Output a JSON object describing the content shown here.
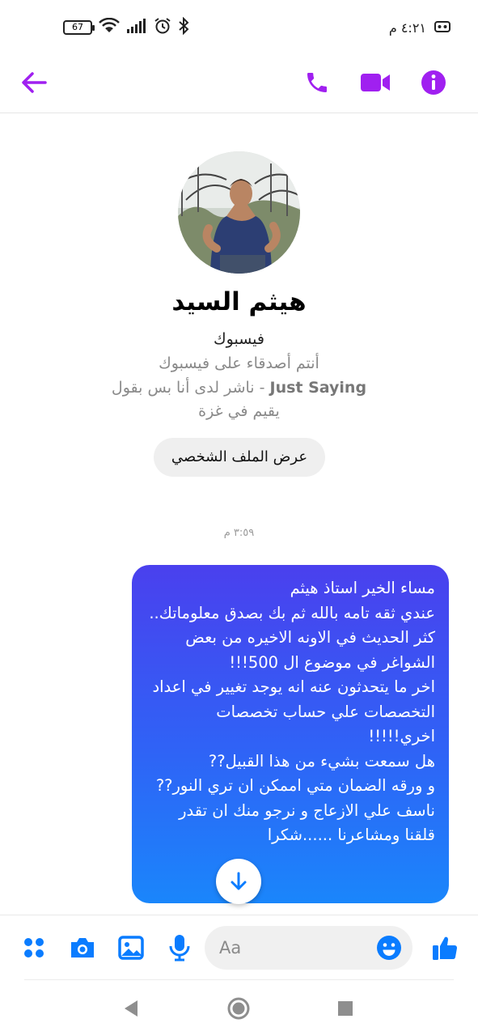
{
  "status_bar": {
    "battery": "67",
    "time": "٤:٢١ م"
  },
  "header": {
    "back_icon": "arrow-left-icon",
    "call_icon": "phone-icon",
    "video_icon": "video-camera-icon",
    "info_icon": "info-icon",
    "accent_color": "#a020f0"
  },
  "profile": {
    "name": "هيثم السيد",
    "platform": "فيسبوك",
    "friends_line": "أنتم أصدقاء على فيسبوك",
    "page_line_bold": "Just Saying",
    "page_line_rest": " - ناشر لدى أنا بس بقول",
    "location": "يقيم في غزة",
    "view_profile_button": "عرض الملف الشخصي"
  },
  "conversation": {
    "timestamp": "٣:٥٩ م",
    "messages": [
      {
        "direction": "outgoing",
        "text": "مساء الخير استاذ هيثم\nعندي ثقه تامه بالله ثم بك بصدق معلوماتك..\nكثر الحديث في الاونه الاخيره من بعض الشواغر في موضوع ال 500!!!\nاخر ما يتحدثون عنه انه يوجد تغيير في اعداد التخصصات علي حساب تخصصات اخري!!!!!\nهل سمعت بشيء من هذا القبيل??\nو ورقه الضمان متي اممكن ان تري النور??\nناسف علي الازعاج و نرجو منك ان تقدر قلقنا ومشاعرنا ......شكرا"
      }
    ],
    "bubble_colors": [
      "#4a40ee",
      "#1a86fb"
    ]
  },
  "composer": {
    "placeholder": "Aa",
    "icons": [
      "menu-dots-icon",
      "camera-icon",
      "gallery-icon",
      "microphone-icon",
      "emoji-icon",
      "thumbs-up-icon"
    ],
    "accent_color": "#0a7cff"
  }
}
